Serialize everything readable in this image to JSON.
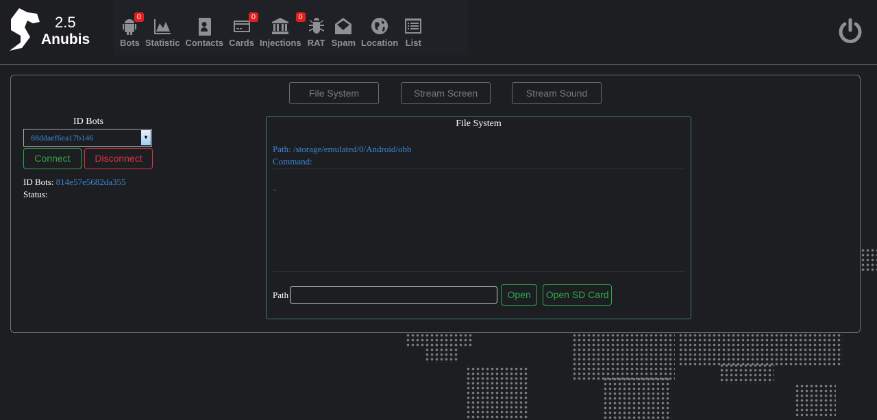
{
  "brand": {
    "version": "2.5",
    "name": "Anubis"
  },
  "nav": [
    {
      "label": "Bots",
      "icon": "android-icon",
      "badge": "0"
    },
    {
      "label": "Statistic",
      "icon": "area-chart-icon"
    },
    {
      "label": "Contacts",
      "icon": "address-book-icon"
    },
    {
      "label": "Cards",
      "icon": "credit-card-icon",
      "badge": "0"
    },
    {
      "label": "Injections",
      "icon": "bank-icon",
      "badge": "0"
    },
    {
      "label": "RAT",
      "icon": "bug-icon"
    },
    {
      "label": "Spam",
      "icon": "envelope-open-icon"
    },
    {
      "label": "Location",
      "icon": "globe-icon"
    },
    {
      "label": "List",
      "icon": "list-icon"
    }
  ],
  "tabs": [
    "File System",
    "Stream Screen",
    "Stream Sound"
  ],
  "left": {
    "heading": "ID Bots",
    "selected": "88ddaef6ea17b146",
    "connect": "Connect",
    "disconnect": "Disconnect",
    "id_label": "ID Bots:",
    "id_value": "814e57e5682da355",
    "status_label": "Status:",
    "status_value": ""
  },
  "fs": {
    "title": "File System",
    "path_line": "Path: /storage/emulated/0/Android/obb",
    "command_line": "Command:",
    "entries": [
      ".."
    ],
    "path_label": "Path",
    "path_value": "",
    "open": "Open",
    "open_sd": "Open SD Card"
  },
  "colors": {
    "accent_blue": "#3c87d4",
    "green": "#2ea84a",
    "red": "#d9363e",
    "badge": "#e0201e"
  }
}
